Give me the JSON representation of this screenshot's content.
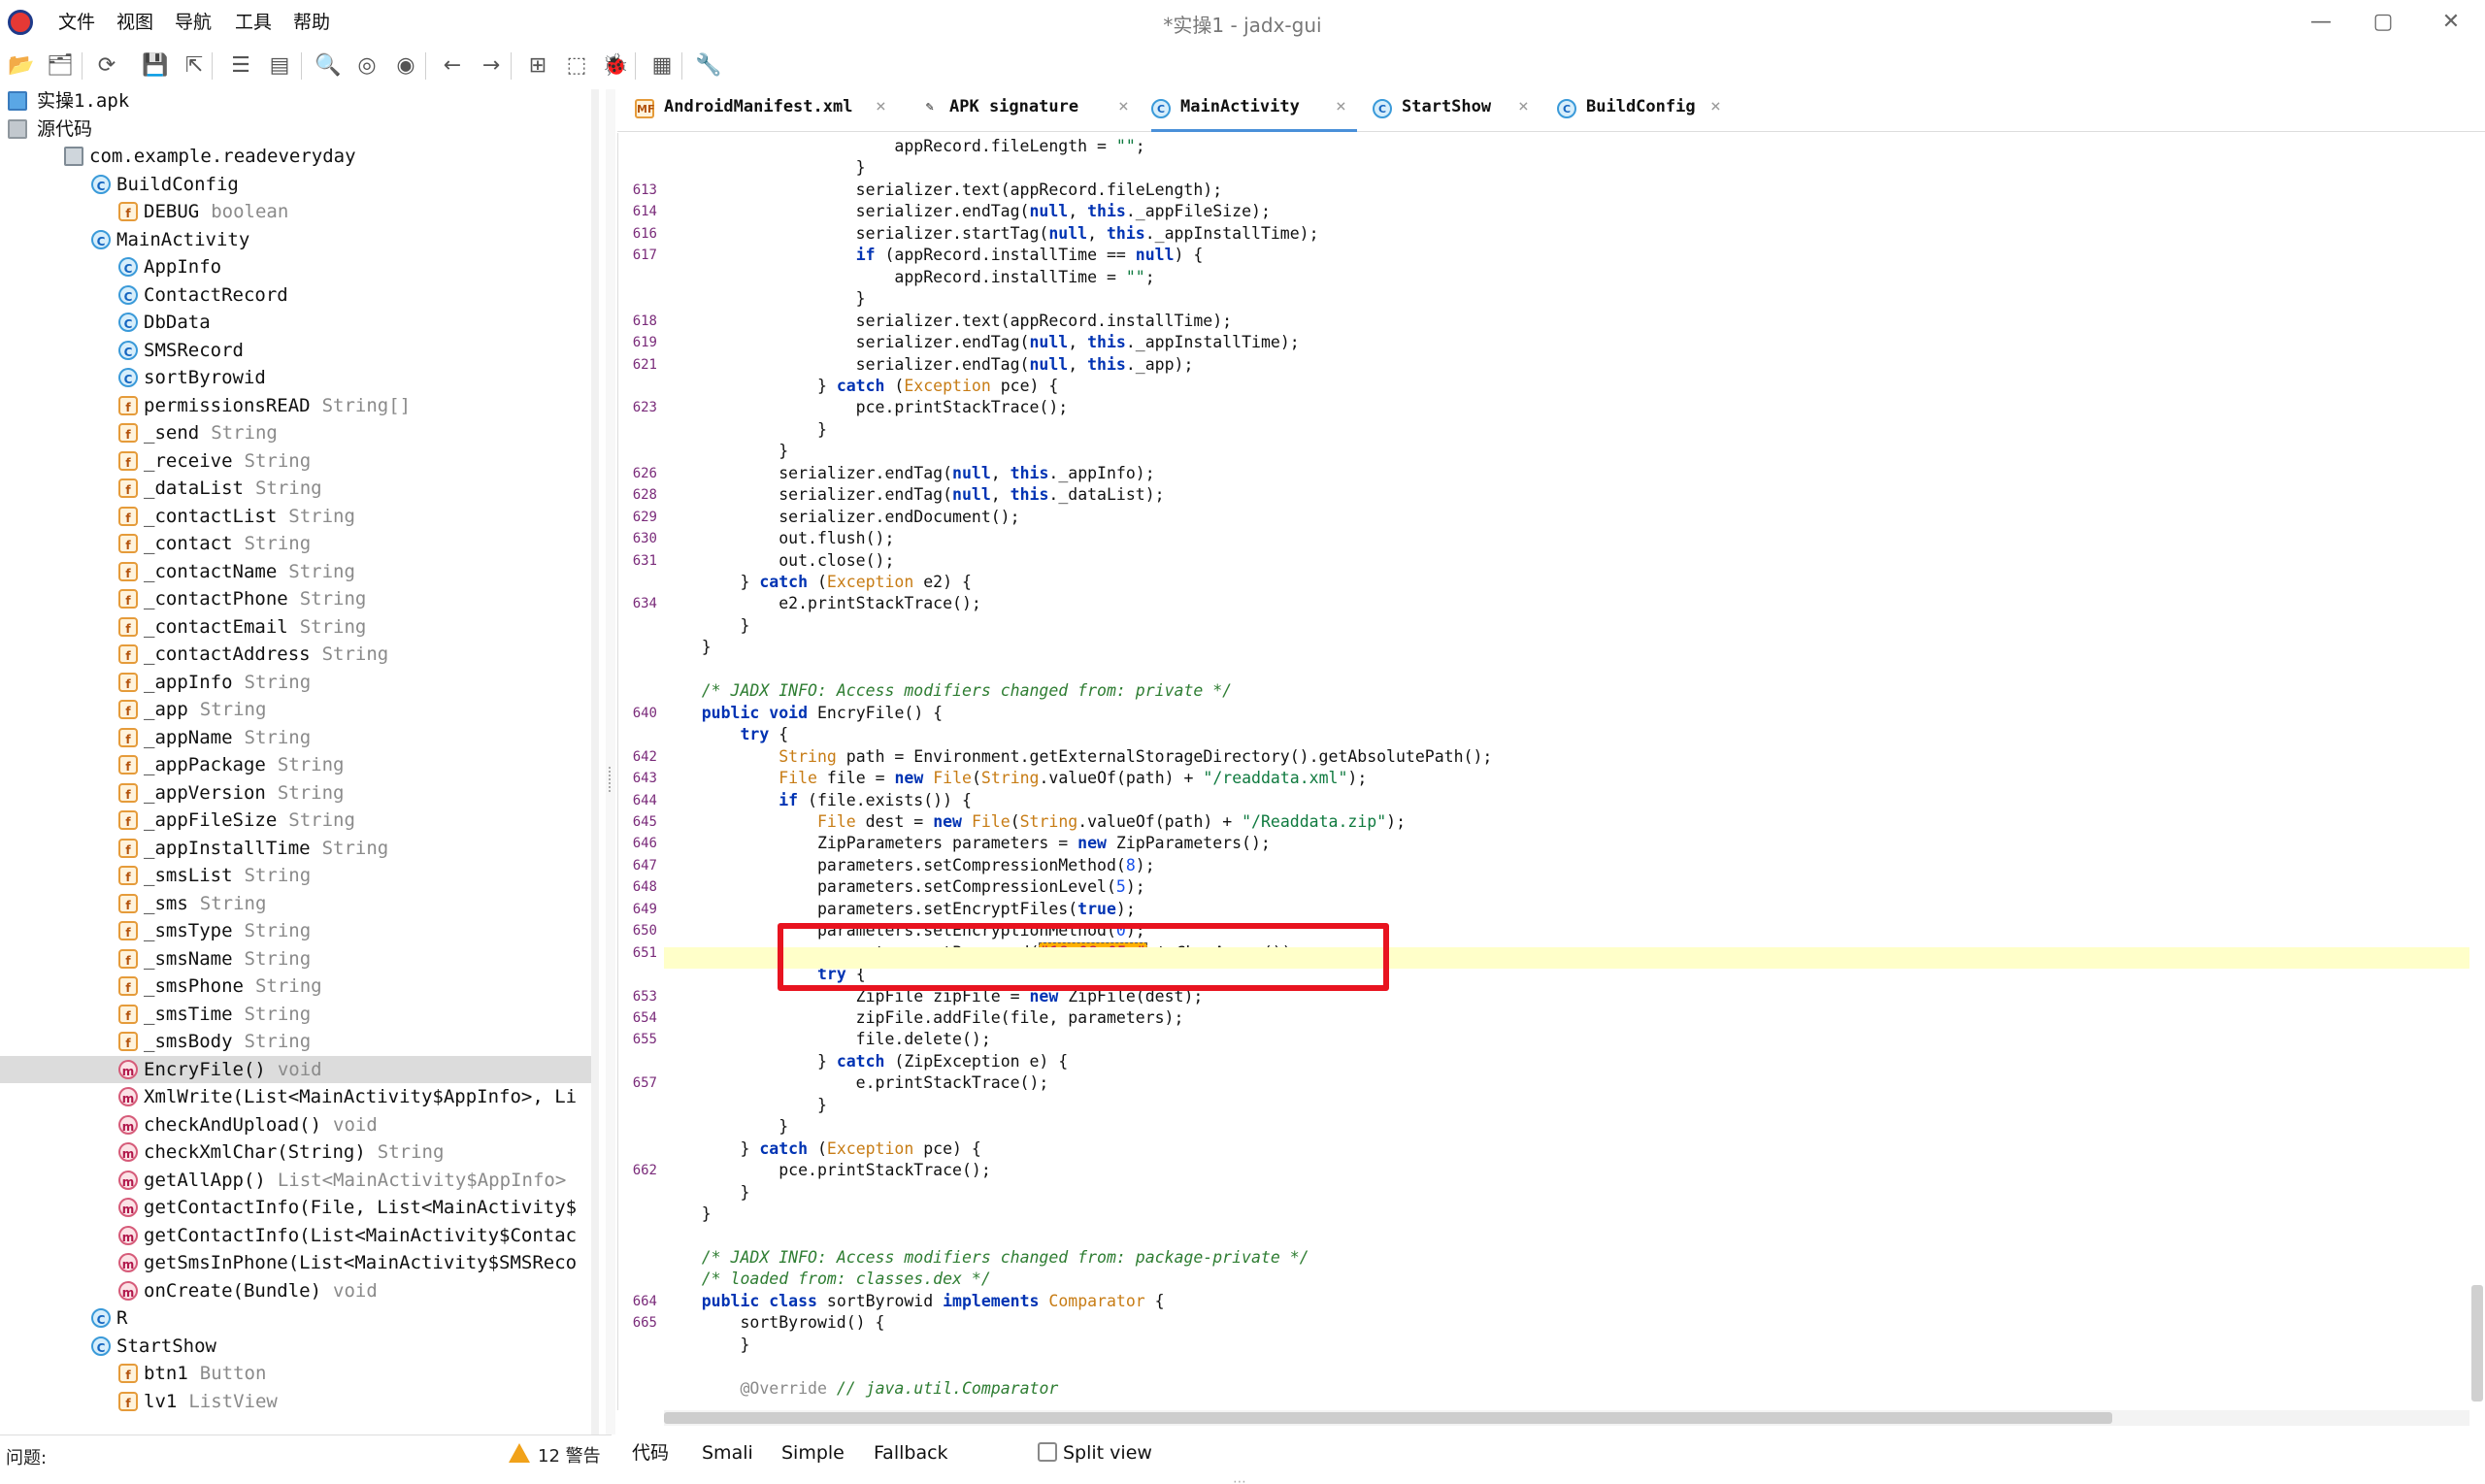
{
  "window": {
    "title": "*实操1 - jadx-gui",
    "menu": [
      "文件",
      "视图",
      "导航",
      "工具",
      "帮助"
    ],
    "controls": {
      "minimize": "—",
      "maximize": "▢",
      "close": "✕"
    }
  },
  "toolbar": {
    "icons": [
      "open-file-icon",
      "add-files-icon",
      "reload-icon",
      "save-all-icon",
      "export-icon",
      "sync-tree-icon",
      "flatten-packages-icon",
      "search-icon",
      "find-usage-icon",
      "deobfuscate-icon",
      "back-icon",
      "forward-icon",
      "log-viewer-icon",
      "quark-icon",
      "debugger-icon",
      "show-log-icon",
      "preferences-icon"
    ],
    "glyphs": [
      "📂",
      "🗂",
      "⟳",
      "💾",
      "⇱",
      "☰",
      "▤",
      "🔍",
      "◎",
      "◉",
      "←",
      "→",
      "⊞",
      "⬚",
      "🐞",
      "▦",
      "🔧"
    ]
  },
  "tree": [
    {
      "d": 0,
      "chev": "",
      "icon": "apk",
      "label": "实操1.apk",
      "type": ""
    },
    {
      "d": 0,
      "chev": "⌄",
      "icon": "src",
      "label": "源代码",
      "type": ""
    },
    {
      "d": 1,
      "chev": "⌄",
      "icon": "pkg",
      "label": "com.example.readeveryday",
      "type": ""
    },
    {
      "d": 2,
      "chev": "⌄",
      "icon": "c",
      "label": "BuildConfig",
      "type": ""
    },
    {
      "d": 3,
      "chev": "",
      "icon": "f",
      "label": "DEBUG",
      "type": "boolean"
    },
    {
      "d": 2,
      "chev": "⌄",
      "icon": "c",
      "label": "MainActivity",
      "type": ""
    },
    {
      "d": 3,
      "chev": "›",
      "icon": "c",
      "label": "AppInfo",
      "type": ""
    },
    {
      "d": 3,
      "chev": "›",
      "icon": "c",
      "label": "ContactRecord",
      "type": ""
    },
    {
      "d": 3,
      "chev": "›",
      "icon": "c",
      "label": "DbData",
      "type": ""
    },
    {
      "d": 3,
      "chev": "›",
      "icon": "c",
      "label": "SMSRecord",
      "type": ""
    },
    {
      "d": 3,
      "chev": "›",
      "icon": "c",
      "label": "sortByrowid",
      "type": ""
    },
    {
      "d": 3,
      "chev": "",
      "icon": "f",
      "label": "permissionsREAD",
      "type": "String[]"
    },
    {
      "d": 3,
      "chev": "",
      "icon": "f",
      "label": "_send",
      "type": "String"
    },
    {
      "d": 3,
      "chev": "",
      "icon": "f",
      "label": "_receive",
      "type": "String"
    },
    {
      "d": 3,
      "chev": "",
      "icon": "f",
      "label": "_dataList",
      "type": "String"
    },
    {
      "d": 3,
      "chev": "",
      "icon": "f",
      "label": "_contactList",
      "type": "String"
    },
    {
      "d": 3,
      "chev": "",
      "icon": "f",
      "label": "_contact",
      "type": "String"
    },
    {
      "d": 3,
      "chev": "",
      "icon": "f",
      "label": "_contactName",
      "type": "String"
    },
    {
      "d": 3,
      "chev": "",
      "icon": "f",
      "label": "_contactPhone",
      "type": "String"
    },
    {
      "d": 3,
      "chev": "",
      "icon": "f",
      "label": "_contactEmail",
      "type": "String"
    },
    {
      "d": 3,
      "chev": "",
      "icon": "f",
      "label": "_contactAddress",
      "type": "String"
    },
    {
      "d": 3,
      "chev": "",
      "icon": "f",
      "label": "_appInfo",
      "type": "String"
    },
    {
      "d": 3,
      "chev": "",
      "icon": "f",
      "label": "_app",
      "type": "String"
    },
    {
      "d": 3,
      "chev": "",
      "icon": "f",
      "label": "_appName",
      "type": "String"
    },
    {
      "d": 3,
      "chev": "",
      "icon": "f",
      "label": "_appPackage",
      "type": "String"
    },
    {
      "d": 3,
      "chev": "",
      "icon": "f",
      "label": "_appVersion",
      "type": "String"
    },
    {
      "d": 3,
      "chev": "",
      "icon": "f",
      "label": "_appFileSize",
      "type": "String"
    },
    {
      "d": 3,
      "chev": "",
      "icon": "f",
      "label": "_appInstallTime",
      "type": "String"
    },
    {
      "d": 3,
      "chev": "",
      "icon": "f",
      "label": "_smsList",
      "type": "String"
    },
    {
      "d": 3,
      "chev": "",
      "icon": "f",
      "label": "_sms",
      "type": "String"
    },
    {
      "d": 3,
      "chev": "",
      "icon": "f",
      "label": "_smsType",
      "type": "String"
    },
    {
      "d": 3,
      "chev": "",
      "icon": "f",
      "label": "_smsName",
      "type": "String"
    },
    {
      "d": 3,
      "chev": "",
      "icon": "f",
      "label": "_smsPhone",
      "type": "String"
    },
    {
      "d": 3,
      "chev": "",
      "icon": "f",
      "label": "_smsTime",
      "type": "String"
    },
    {
      "d": 3,
      "chev": "",
      "icon": "f",
      "label": "_smsBody",
      "type": "String"
    },
    {
      "d": 3,
      "chev": "",
      "icon": "m",
      "label": "EncryFile()",
      "type": "void",
      "selected": true
    },
    {
      "d": 3,
      "chev": "",
      "icon": "m",
      "label": "XmlWrite(List<MainActivity$AppInfo>, Li",
      "type": ""
    },
    {
      "d": 3,
      "chev": "",
      "icon": "m",
      "label": "checkAndUpload()",
      "type": "void"
    },
    {
      "d": 3,
      "chev": "",
      "icon": "m",
      "label": "checkXmlChar(String)",
      "type": "String"
    },
    {
      "d": 3,
      "chev": "",
      "icon": "m",
      "label": "getAllApp()",
      "type": "List<MainActivity$AppInfo>"
    },
    {
      "d": 3,
      "chev": "",
      "icon": "m",
      "label": "getContactInfo(File, List<MainActivity$",
      "type": ""
    },
    {
      "d": 3,
      "chev": "",
      "icon": "m",
      "label": "getContactInfo(List<MainActivity$Contac",
      "type": ""
    },
    {
      "d": 3,
      "chev": "",
      "icon": "m",
      "label": "getSmsInPhone(List<MainActivity$SMSReco",
      "type": ""
    },
    {
      "d": 3,
      "chev": "",
      "icon": "m",
      "label": "onCreate(Bundle)",
      "type": "void"
    },
    {
      "d": 2,
      "chev": "›",
      "icon": "c",
      "label": "R",
      "type": ""
    },
    {
      "d": 2,
      "chev": "⌄",
      "icon": "c",
      "label": "StartShow",
      "type": ""
    },
    {
      "d": 3,
      "chev": "",
      "icon": "f",
      "label": "btn1",
      "type": "Button"
    },
    {
      "d": 3,
      "chev": "",
      "icon": "f",
      "label": "lv1",
      "type": "ListView"
    }
  ],
  "tabs": [
    {
      "label": "AndroidManifest.xml",
      "icon": "MF",
      "active": false
    },
    {
      "label": "APK signature",
      "icon": "✎",
      "active": false
    },
    {
      "label": "MainActivity",
      "icon": "C",
      "active": true
    },
    {
      "label": "StartShow",
      "icon": "C",
      "active": false
    },
    {
      "label": "BuildConfig",
      "icon": "C",
      "active": false
    }
  ],
  "tab_close": "×",
  "code": [
    [
      "",
      "                        appRecord.fileLength = <s>\"\"</s>;"
    ],
    [
      "",
      "                    }"
    ],
    [
      "613",
      "                    serializer.text(appRecord.fileLength);"
    ],
    [
      "614",
      "                    serializer.endTag(<k>null</k>, <k>this</k>._appFileSize);"
    ],
    [
      "616",
      "                    serializer.startTag(<k>null</k>, <k>this</k>._appInstallTime);"
    ],
    [
      "617",
      "                    <k>if</k> (appRecord.installTime == <k>null</k>) {"
    ],
    [
      "",
      "                        appRecord.installTime = <s>\"\"</s>;"
    ],
    [
      "",
      "                    }"
    ],
    [
      "618",
      "                    serializer.text(appRecord.installTime);"
    ],
    [
      "619",
      "                    serializer.endTag(<k>null</k>, <k>this</k>._appInstallTime);"
    ],
    [
      "621",
      "                    serializer.endTag(<k>null</k>, <k>this</k>._app);"
    ],
    [
      "",
      "                } <k>catch</k> (<t>Exception</t> pce) {"
    ],
    [
      "623",
      "                    pce.printStackTrace();"
    ],
    [
      "",
      "                }"
    ],
    [
      "",
      "            }"
    ],
    [
      "626",
      "            serializer.endTag(<k>null</k>, <k>this</k>._appInfo);"
    ],
    [
      "628",
      "            serializer.endTag(<k>null</k>, <k>this</k>._dataList);"
    ],
    [
      "629",
      "            serializer.endDocument();"
    ],
    [
      "630",
      "            out.flush();"
    ],
    [
      "631",
      "            out.close();"
    ],
    [
      "",
      "        } <k>catch</k> (<t>Exception</t> e2) {"
    ],
    [
      "634",
      "            e2.printStackTrace();"
    ],
    [
      "",
      "        }"
    ],
    [
      "",
      "    }"
    ],
    [
      "",
      ""
    ],
    [
      "",
      "    <c>/* JADX INFO: Access modifiers changed from: private */</c>"
    ],
    [
      "640",
      "    <k>public</k> <k>void</k> EncryFile() {"
    ],
    [
      "",
      "        <k>try</k> {"
    ],
    [
      "642",
      "            <t>String</t> path = Environment.getExternalStorageDirectory().getAbsolutePath();"
    ],
    [
      "643",
      "            <t>File</t> file = <k>new</k> <t>File</t>(<t>String</t>.valueOf(path) + <s>\"/readdata.xml\"</s>);"
    ],
    [
      "644",
      "            <k>if</k> (file.exists()) {"
    ],
    [
      "645",
      "                <t>File</t> dest = <k>new</k> <t>File</t>(<t>String</t>.valueOf(path) + <s>\"/Readdata.zip\"</s>);"
    ],
    [
      "646",
      "                ZipParameters parameters = <k>new</k> ZipParameters();"
    ],
    [
      "647",
      "                parameters.setCompressionMethod(<n>8</n>);"
    ],
    [
      "648",
      "                parameters.setCompressionLevel(<n>5</n>);"
    ],
    [
      "649",
      "                parameters.setEncryptFiles(<k>true</k>);"
    ],
    [
      "650",
      "                parameters.setEncryptionMethod(<n>0</n>);"
    ],
    [
      "651",
      "                parameters.setPassword(<x>\"19_08.05r\"</x>.toCharArray());"
    ],
    [
      "",
      "                <k>try</k> {"
    ],
    [
      "653",
      "                    ZipFile zipFile = <k>new</k> ZipFile(dest);"
    ],
    [
      "654",
      "                    zipFile.addFile(file, parameters);"
    ],
    [
      "655",
      "                    file.delete();"
    ],
    [
      "",
      "                } <k>catch</k> (ZipException e) {"
    ],
    [
      "657",
      "                    e.printStackTrace();"
    ],
    [
      "",
      "                }"
    ],
    [
      "",
      "            }"
    ],
    [
      "",
      "        } <k>catch</k> (<t>Exception</t> pce) {"
    ],
    [
      "662",
      "            pce.printStackTrace();"
    ],
    [
      "",
      "        }"
    ],
    [
      "",
      "    }"
    ],
    [
      "",
      ""
    ],
    [
      "",
      "    <c>/* JADX INFO: Access modifiers changed from: package-private */</c>"
    ],
    [
      "",
      "    <c>/* loaded from: classes.dex */</c>"
    ],
    [
      "664",
      "    <k>public</k> <k>class</k> sortByrowid <k>implements</k> <t>Comparator</t> {"
    ],
    [
      "665",
      "        sortByrowid() {"
    ],
    [
      "",
      "        }"
    ],
    [
      "",
      ""
    ],
    [
      "",
      "        <an>@Override</an> <c>// java.util.Comparator</c>"
    ]
  ],
  "bottom_tabs": [
    "代码",
    "Smali",
    "Simple",
    "Fallback"
  ],
  "split_view_label": "Split view",
  "status": {
    "label": "问题:",
    "warnings": "12 警告"
  },
  "resize_grip": "⋯",
  "colors": {
    "highlight_box": "#e8131f",
    "password_highlight": "#ffb000",
    "active_tab_underline": "#4a90d9"
  }
}
